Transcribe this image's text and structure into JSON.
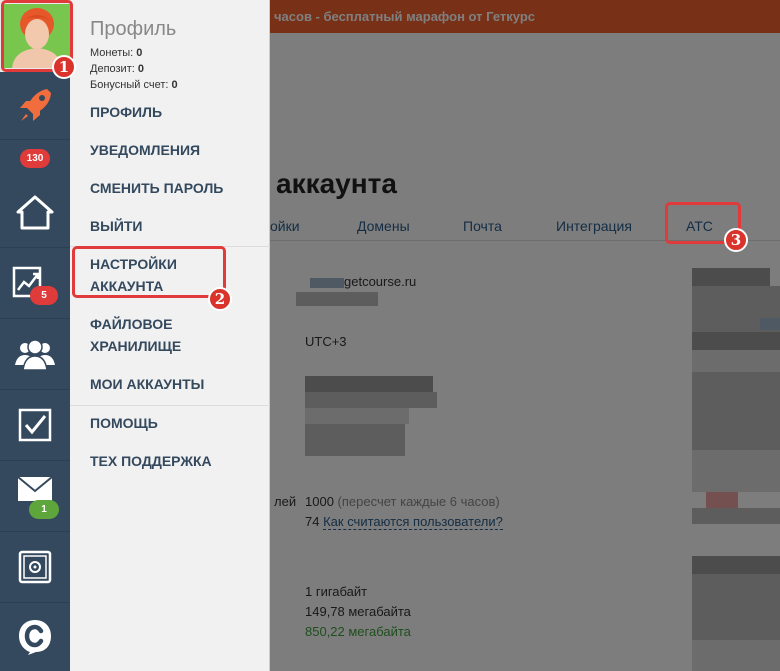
{
  "banner": {
    "text": "часов - бесплатный марафон от Геткурс"
  },
  "page": {
    "title": "аккаунта"
  },
  "tabs": [
    {
      "label": "ойки"
    },
    {
      "label": "Домены"
    },
    {
      "label": "Почта"
    },
    {
      "label": "Интеграция"
    },
    {
      "label": "АТС"
    }
  ],
  "content": {
    "domain": "getcourse.ru",
    "timezone": "UTC+3",
    "users_label": "лей",
    "users_limit": "1000",
    "users_note": "(пересчет каждые 6 часов)",
    "users_count": "74",
    "users_link": "Как считаются пользователи?",
    "storage_total": "1 гигабайт",
    "storage_used": "149,78 мегабайта",
    "storage_free": "850,22 мегабайта"
  },
  "rail": {
    "badges": {
      "top": "130",
      "chart": "5",
      "mail": "1"
    },
    "icons": [
      "rocket-icon",
      "home-icon",
      "chart-icon",
      "users-icon",
      "checkbox-icon",
      "mail-icon",
      "safe-icon",
      "getcourse-logo-icon"
    ]
  },
  "profile": {
    "title": "Профиль",
    "coins_label": "Монеты:",
    "coins": "0",
    "deposit_label": "Депозит:",
    "deposit": "0",
    "bonus_label": "Бонусный счет:",
    "bonus": "0"
  },
  "menu": {
    "profile": "ПРОФИЛЬ",
    "notifications": "УВЕДОМЛЕНИЯ",
    "change_password": "СМЕНИТЬ ПАРОЛЬ",
    "logout": "ВЫЙТИ",
    "account_settings_1": "НАСТРОЙКИ",
    "account_settings_2": "АККАУНТА",
    "file_storage_1": "ФАЙЛОВОЕ",
    "file_storage_2": "ХРАНИЛИЩЕ",
    "my_accounts": "МОИ АККАУНТЫ",
    "help": "ПОМОЩЬ",
    "support": "ТЕХ ПОДДЕРЖКА"
  },
  "annotations": {
    "one": "1",
    "two": "2",
    "three": "3"
  },
  "colors": {
    "rail": "#34495e",
    "banner": "#f0602c",
    "highlight": "#e03a3a",
    "badge_red": "#e03b3b",
    "badge_green": "#5ea63b"
  }
}
